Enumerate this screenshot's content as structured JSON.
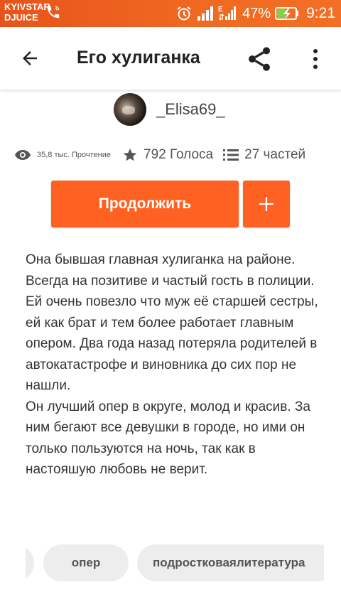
{
  "status_bar": {
    "carrier_line1": "KYIVSTAR",
    "carrier_line2": "DJUICE",
    "battery_percent": "47%",
    "time": "9:21",
    "signal_label": "E"
  },
  "app_bar": {
    "title": "Его хулиганка"
  },
  "author": {
    "name": "_Elisa69_"
  },
  "stats": {
    "reads": "35,8 тыс. Прочтение",
    "votes": "792 Голоса",
    "parts": "27 частей"
  },
  "actions": {
    "continue_label": "Продолжить",
    "add_label": "+"
  },
  "description": {
    "paragraph1": "Она бывшая главная хулиганка на районе. Всегда на позитиве и частый гость в полиции. Ей очень повезло что муж её старшей сестры, ей как брат и тем более работает главным опером. Два года назад потеряла родителей в автокатастрофе и виновника до сих пор не нашли.",
    "paragraph2": "Он лучший опер в округе, молод и красив. За ним бегают все девушки в городе, но ими он только пользуются на ночь, так как в настояшую любовь не верит."
  },
  "tags": [
    "опер",
    "подростковаялитература"
  ],
  "colors": {
    "accent": "#ff6122",
    "status_bar": "#f06a22"
  }
}
